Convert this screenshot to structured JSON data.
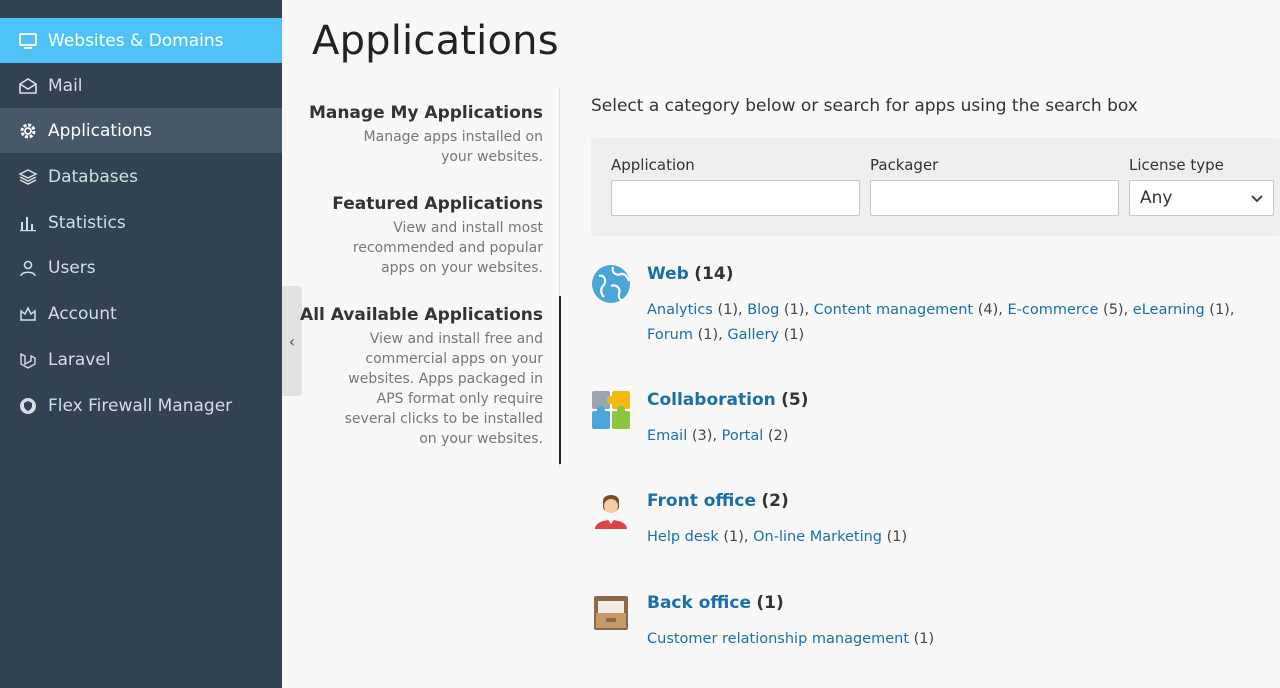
{
  "sidebar": {
    "items": [
      {
        "label": "Websites & Domains",
        "icon": "monitor-icon"
      },
      {
        "label": "Mail",
        "icon": "mail-icon"
      },
      {
        "label": "Applications",
        "icon": "gear-icon"
      },
      {
        "label": "Databases",
        "icon": "layers-icon"
      },
      {
        "label": "Statistics",
        "icon": "bar-chart-icon"
      },
      {
        "label": "Users",
        "icon": "user-icon"
      },
      {
        "label": "Account",
        "icon": "account-icon"
      },
      {
        "label": "Laravel",
        "icon": "laravel-icon"
      },
      {
        "label": "Flex Firewall Manager",
        "icon": "shield-icon"
      }
    ]
  },
  "page": {
    "title": "Applications",
    "collapse_glyph": "‹"
  },
  "subnav": {
    "items": [
      {
        "title": "Manage My Applications",
        "desc": [
          "Manage apps installed on",
          "your websites."
        ]
      },
      {
        "title": "Featured Applications",
        "desc": [
          "View and install most",
          "recommended and popular",
          "apps on your websites."
        ]
      },
      {
        "title": "All Available Applications",
        "desc": [
          "View and install free and",
          "commercial apps on your",
          "websites. Apps packaged in",
          "APS format only require",
          "several clicks to be installed",
          "on your websites."
        ]
      }
    ]
  },
  "search": {
    "intro": "Select a category below or search for apps using the search box",
    "application_label": "Application",
    "application_value": "",
    "packager_label": "Packager",
    "packager_value": "",
    "license_label": "License type",
    "license_value": "Any"
  },
  "categories": [
    {
      "name": "Web",
      "count": "(14)",
      "icon": "globe-icon",
      "links": [
        {
          "name": "Analytics",
          "count": "(1)"
        },
        {
          "name": "Blog",
          "count": "(1)"
        },
        {
          "name": "Content management",
          "count": "(4)"
        },
        {
          "name": "E-commerce",
          "count": "(5)"
        },
        {
          "name": "eLearning",
          "count": "(1)"
        },
        {
          "name": "Forum",
          "count": "(1)"
        },
        {
          "name": "Gallery",
          "count": "(1)"
        }
      ]
    },
    {
      "name": "Collaboration",
      "count": "(5)",
      "icon": "puzzle-icon",
      "links": [
        {
          "name": "Email",
          "count": "(3)"
        },
        {
          "name": "Portal",
          "count": "(2)"
        }
      ]
    },
    {
      "name": "Front office",
      "count": "(2)",
      "icon": "person-icon",
      "links": [
        {
          "name": "Help desk",
          "count": "(1)"
        },
        {
          "name": "On-line Marketing",
          "count": "(1)"
        }
      ]
    },
    {
      "name": "Back office",
      "count": "(1)",
      "icon": "drawer-icon",
      "links": [
        {
          "name": "Customer relationship management",
          "count": "(1)"
        }
      ]
    }
  ],
  "colors": {
    "sidebar_bg": "#334252",
    "sidebar_active_top": "#4fc3f7",
    "sidebar_active": "#465869",
    "link": "#1b6fa8"
  }
}
